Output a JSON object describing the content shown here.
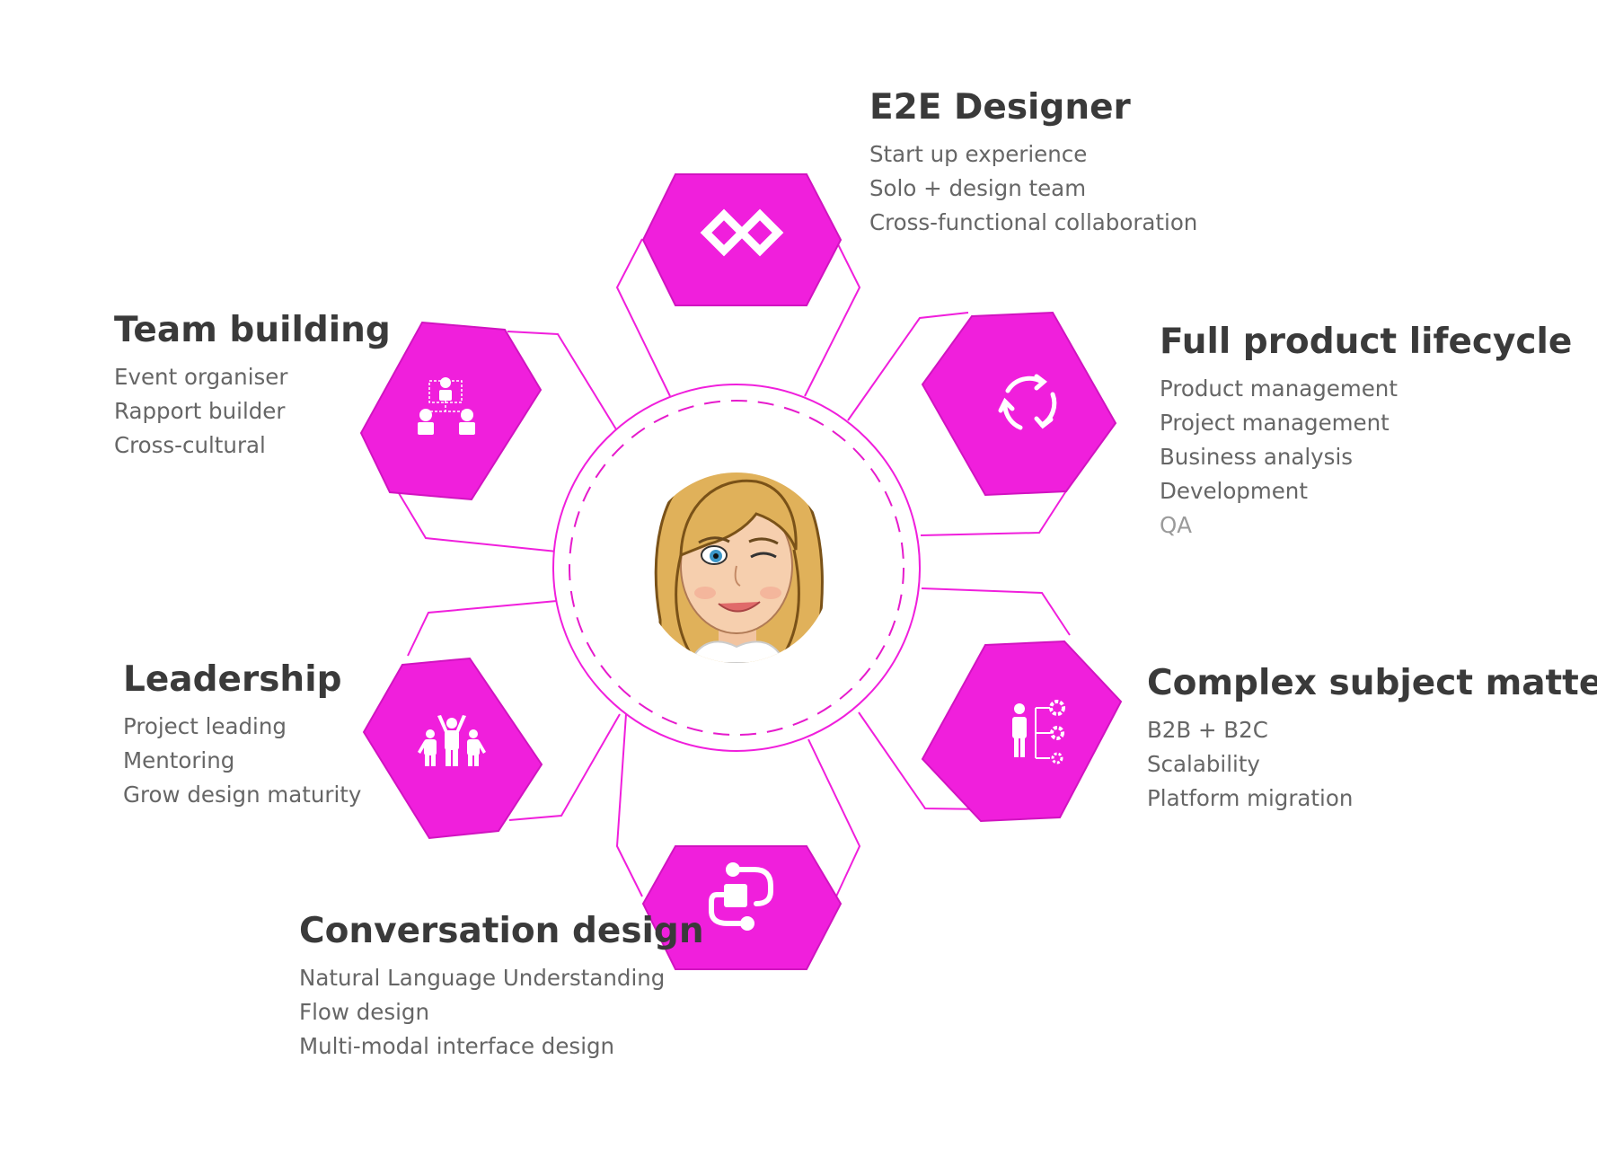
{
  "accent_color": "#f01fdc",
  "center": {
    "avatar": "winking-blonde-avatar"
  },
  "skills": [
    {
      "id": "e2e",
      "title": "E2E Designer",
      "icon": "infinity-icon",
      "items": [
        "Start up experience",
        "Solo + design team",
        "Cross-functional collaboration"
      ]
    },
    {
      "id": "lifecycle",
      "title": "Full product lifecycle",
      "icon": "refresh-cycle-icon",
      "items": [
        "Product management",
        "Project management",
        "Business analysis",
        "Development",
        "QA"
      ]
    },
    {
      "id": "complex",
      "title": "Complex subject matter",
      "icon": "person-gears-icon",
      "items": [
        "B2B + B2C",
        "Scalability",
        "Platform migration"
      ]
    },
    {
      "id": "conversation",
      "title": "Conversation design",
      "icon": "flow-diagram-icon",
      "items": [
        "Natural Language Understanding",
        "Flow design",
        "Multi-modal interface design"
      ]
    },
    {
      "id": "leadership",
      "title": "Leadership",
      "icon": "group-cheer-icon",
      "items": [
        "Project leading",
        "Mentoring",
        "Grow design maturity"
      ]
    },
    {
      "id": "team",
      "title": "Team building",
      "icon": "org-team-icon",
      "items": [
        "Event organiser",
        "Rapport builder",
        "Cross-cultural"
      ]
    }
  ]
}
